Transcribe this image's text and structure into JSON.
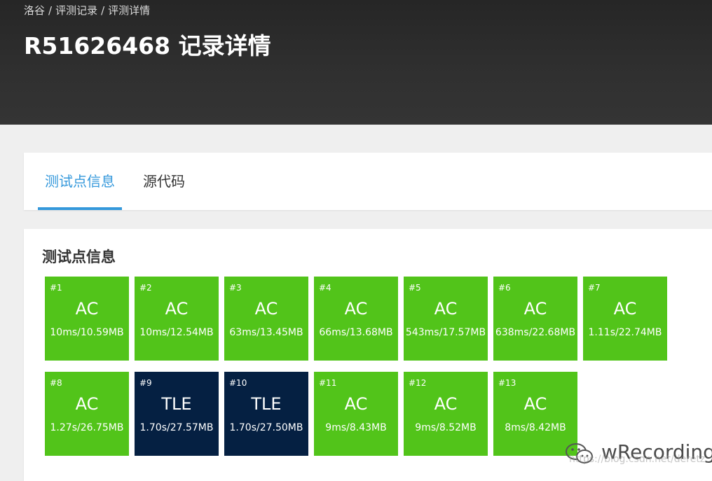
{
  "breadcrumb": [
    "洛谷",
    "评测记录",
    "评测详情"
  ],
  "breadcrumb_sep": "/",
  "title": "R51626468 记录详情",
  "tabs": [
    {
      "label": "测试点信息",
      "active": true
    },
    {
      "label": "源代码",
      "active": false
    }
  ],
  "section_title": "测试点信息",
  "testcases": [
    {
      "num": "#1",
      "status": "AC",
      "info": "10ms/10.59MB"
    },
    {
      "num": "#2",
      "status": "AC",
      "info": "10ms/12.54MB"
    },
    {
      "num": "#3",
      "status": "AC",
      "info": "63ms/13.45MB"
    },
    {
      "num": "#4",
      "status": "AC",
      "info": "66ms/13.68MB"
    },
    {
      "num": "#5",
      "status": "AC",
      "info": "543ms/17.57MB"
    },
    {
      "num": "#6",
      "status": "AC",
      "info": "638ms/22.68MB"
    },
    {
      "num": "#7",
      "status": "AC",
      "info": "1.11s/22.74MB"
    },
    {
      "num": "#8",
      "status": "AC",
      "info": "1.27s/26.75MB"
    },
    {
      "num": "#9",
      "status": "TLE",
      "info": "1.70s/27.57MB"
    },
    {
      "num": "#10",
      "status": "TLE",
      "info": "1.70s/27.50MB"
    },
    {
      "num": "#11",
      "status": "AC",
      "info": "9ms/8.43MB"
    },
    {
      "num": "#12",
      "status": "AC",
      "info": "9ms/8.52MB"
    },
    {
      "num": "#13",
      "status": "AC",
      "info": "8ms/8.42MB"
    }
  ],
  "colors": {
    "ac": "#52c41a",
    "tle": "#052042",
    "accent": "#3498db"
  },
  "watermark": {
    "text": "wRecording",
    "url": "https://blog.csdn.net/deretz",
    "icon": "wechat-icon"
  }
}
